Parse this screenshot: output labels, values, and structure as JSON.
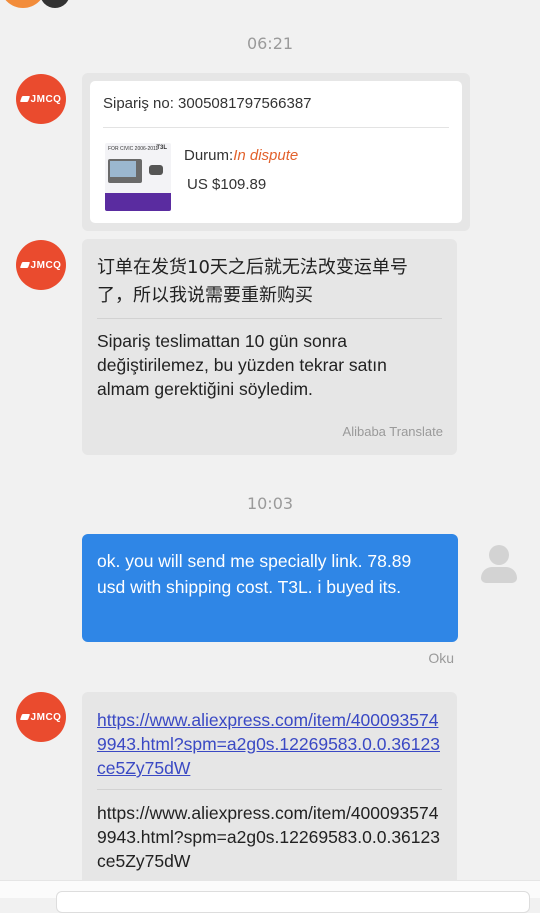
{
  "timestamps": [
    "06:21",
    "10:03"
  ],
  "shop": {
    "avatar_text": "JMCQ"
  },
  "order_card": {
    "order_no": "Sipariş no: 3005081797566387",
    "status_label": "Durum:",
    "status_value": "In dispute",
    "price": "US $109.89",
    "thumb_title": "FOR CIVIC 2006-2011",
    "thumb_badge": "T3L"
  },
  "message1": {
    "original": "订单在发货10天之后就无法改变运单号了，所以我说需要重新购买",
    "translation": "Sipariş teslimattan 10 gün sonra değiştirilemez, bu yüzden tekrar satın almam gerektiğini söyledim.",
    "translator": "Alibaba Translate"
  },
  "message2": {
    "text": "ok. you will send me specially link. 78.89 usd with shipping cost. T3L. i buyed its.",
    "read_status": "Oku"
  },
  "message3": {
    "link": "https://www.aliexpress.com/item/4000935749943.html?spm=a2g0s.12269583.0.0.36123ce5Zy75dW",
    "plain": "https://www.aliexpress.com/item/4000935749943.html?spm=a2g0s.12269583.0.0.36123ce5Zy75dW"
  },
  "colors": {
    "outgoing_bubble": "#2f86e6",
    "incoming_bubble": "#e6e6e6",
    "status_dispute": "#e2622d",
    "avatar": "#ea4b2e",
    "link": "#3a49c4"
  }
}
